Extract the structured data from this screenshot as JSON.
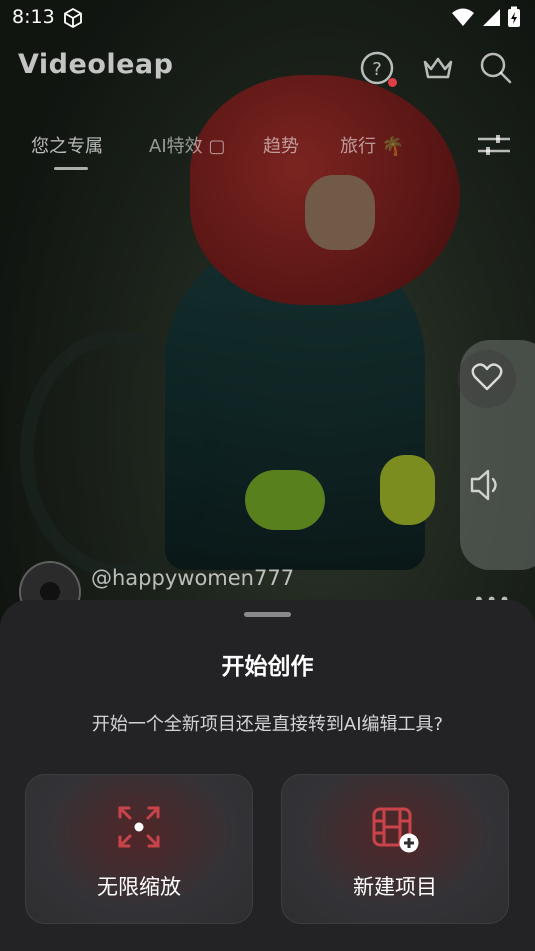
{
  "status_bar": {
    "time": "8:13"
  },
  "app": {
    "logo": "Videoleap"
  },
  "top_icons": [
    "help-icon",
    "crown-icon",
    "search-icon"
  ],
  "tabs": [
    {
      "label": "您之专属",
      "active": true
    },
    {
      "label": "AI特效 ▢",
      "active": false
    },
    {
      "label": "趋势",
      "active": false
    },
    {
      "label": "旅行 🌴",
      "active": false
    }
  ],
  "post": {
    "username": "@happywomen777"
  },
  "sheet": {
    "title": "开始创作",
    "subtitle": "开始一个全新项目还是直接转到AI编辑工具?",
    "options": [
      {
        "label": "无限缩放",
        "icon": "expand-icon"
      },
      {
        "label": "新建项目",
        "icon": "film-add-icon"
      }
    ]
  },
  "colors": {
    "accent": "#c8434a",
    "sheet_bg": "#232326",
    "card_bg": "#333337"
  }
}
